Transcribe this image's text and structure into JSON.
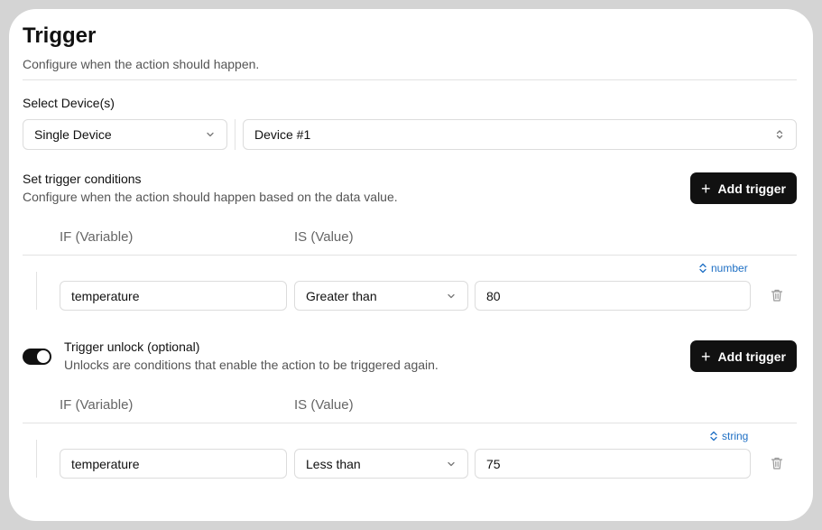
{
  "header": {
    "title": "Trigger",
    "subtitle": "Configure when the action should happen."
  },
  "device": {
    "label": "Select Device(s)",
    "mode_value": "Single Device",
    "device_value": "Device #1"
  },
  "conditions": {
    "title": "Set trigger conditions",
    "description": "Configure when the action should happen based on the data value.",
    "add_label": "Add trigger",
    "col_variable": "IF (Variable)",
    "col_value": "IS (Value)",
    "row": {
      "variable": "temperature",
      "operator": "Greater than",
      "value": "80",
      "type": "number"
    }
  },
  "unlock": {
    "title": "Trigger unlock (optional)",
    "description": "Unlocks are conditions that enable the action to be triggered again.",
    "enabled": true,
    "add_label": "Add trigger",
    "col_variable": "IF (Variable)",
    "col_value": "IS (Value)",
    "row": {
      "variable": "temperature",
      "operator": "Less than",
      "value": "75",
      "type": "string"
    }
  },
  "colors": {
    "accent_dark": "#111111",
    "type_link": "#1e6fc4",
    "frame": "#d4d4d4"
  }
}
